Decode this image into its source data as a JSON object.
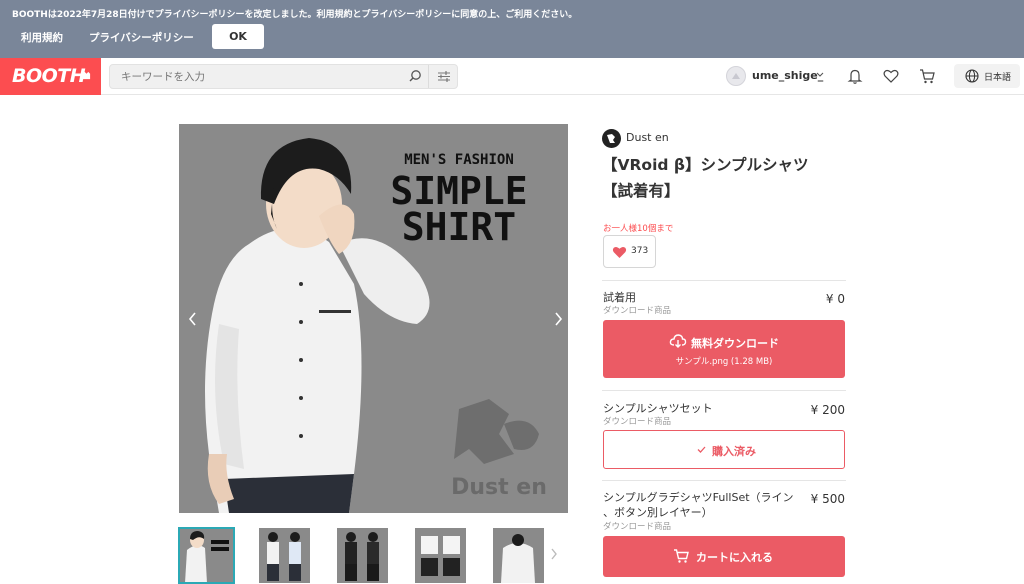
{
  "notice": {
    "text": "BOOTHは2022年7月28日付けでプライバシーポリシーを改定しました。利用規約とプライバシーポリシーに同意の上、ご利用ください。",
    "terms_link": "利用規約",
    "privacy_link": "プライバシーポリシー",
    "ok_label": "OK"
  },
  "header": {
    "logo": "BOOTH",
    "search_placeholder": "キーワードを入力",
    "username": "ume_shige_",
    "language": "日本語"
  },
  "product": {
    "shop_name": "Dust en",
    "title_line1": "【VRoid β】シンプルシャツ",
    "title_line2": "【試着有】",
    "limit_notice": "お一人様10個まで",
    "like_count": "373",
    "image": {
      "heading": "MEN'S FASHION",
      "line1": "SIMPLE",
      "line2": "SHIRT",
      "watermark": "Dust en"
    }
  },
  "variants": [
    {
      "name": "試着用",
      "type": "ダウンロード商品",
      "price": "¥ 0",
      "button_label": "無料ダウンロード",
      "button_sub": "サンプル.png (1.28 MB)"
    },
    {
      "name": "シンプルシャツセット",
      "type": "ダウンロード商品",
      "price": "¥ 200",
      "button_label": "購入済み"
    },
    {
      "name_line1": "シンプルグラデシャツFullSet（ライン",
      "name_line2": "、ボタン別レイヤー）",
      "type": "ダウンロード商品",
      "price": "¥ 500",
      "button_label": "カートに入れる"
    }
  ],
  "colors": {
    "notice_bg": "#7a8699",
    "brand": "#fc4d50",
    "button_red": "#eb5b65",
    "thumb_active": "#2ba9b5"
  }
}
